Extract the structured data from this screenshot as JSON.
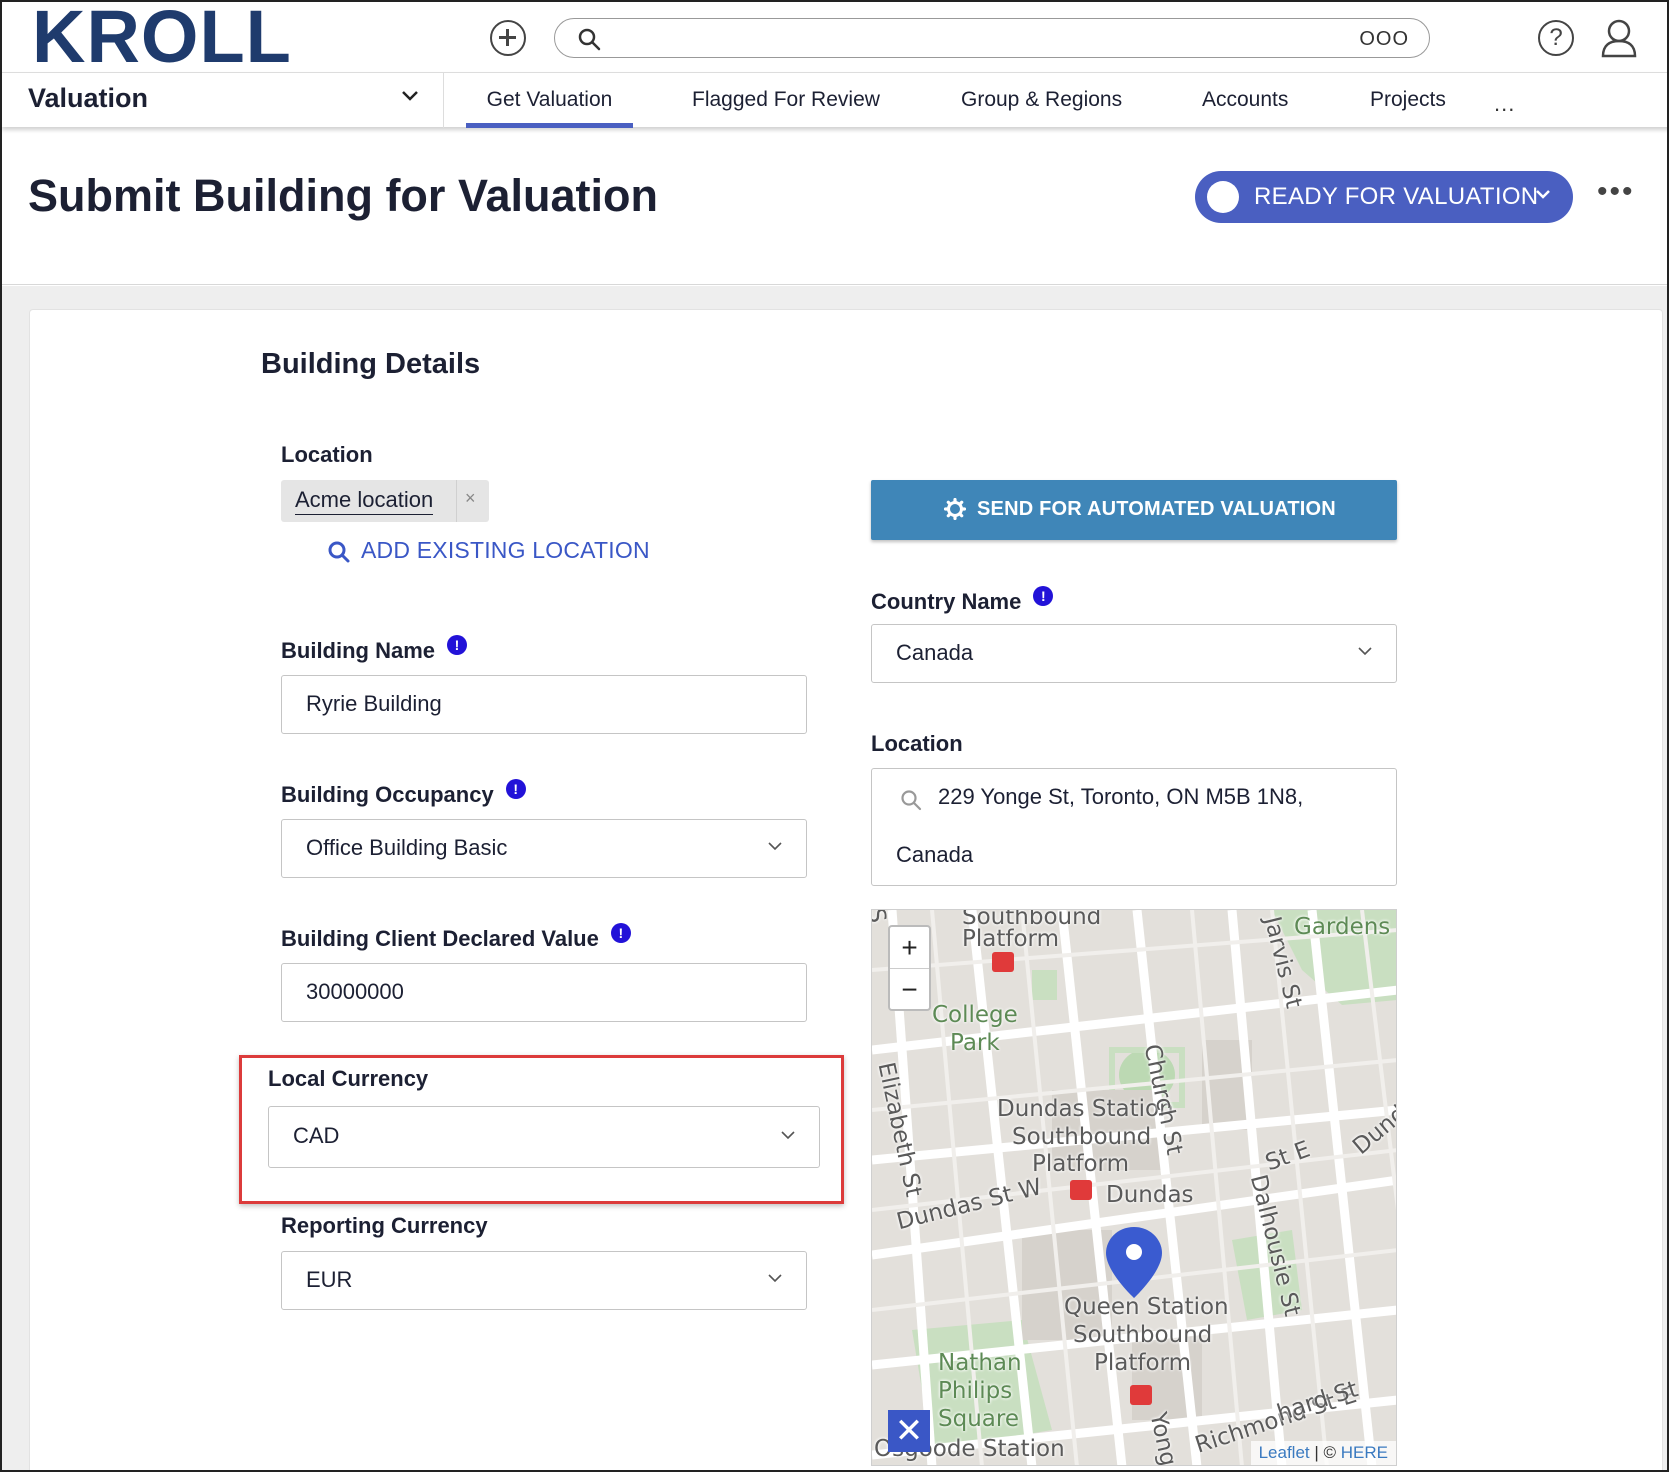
{
  "header": {
    "logo_text": "KROLL",
    "search_placeholder": "",
    "search_more": "OOO"
  },
  "nav": {
    "module": "Valuation",
    "tabs": [
      "Get Valuation",
      "Flagged For Review",
      "Group & Regions",
      "Accounts",
      "Projects"
    ],
    "active_tab": "Get Valuation",
    "more": "..."
  },
  "page": {
    "title": "Submit Building for Valuation",
    "status": "READY FOR VALUATION",
    "kebab": "•••"
  },
  "form": {
    "section_title": "Building Details",
    "location_label": "Location",
    "location_chip": "Acme location",
    "chip_remove": "×",
    "add_existing_location": "ADD EXISTING LOCATION",
    "building_name_label": "Building Name",
    "building_name_value": "Ryrie Building",
    "occupancy_label": "Building Occupancy",
    "occupancy_value": "Office Building Basic",
    "declared_value_label": "Building Client Declared Value",
    "declared_value": "30000000",
    "local_currency_label": "Local Currency",
    "local_currency_value": "CAD",
    "reporting_currency_label": "Reporting Currency",
    "reporting_currency_value": "EUR",
    "send_button": "SEND FOR AUTOMATED VALUATION",
    "country_label": "Country Name",
    "country_value": "Canada",
    "location2_label": "Location",
    "address_line1": "229 Yonge St, Toronto, ON M5B 1N8,",
    "address_line2": "Canada",
    "required_marker": "!"
  },
  "map": {
    "zoom_in": "+",
    "zoom_out": "−",
    "attribution_leaflet": "Leaflet",
    "attribution_sep": " | © ",
    "attribution_here": "HERE",
    "close": "✕",
    "labels": [
      "Southbound",
      "Platform",
      "College",
      "Park",
      "Gardens",
      "Dundas Station",
      "Southbound",
      "Platform",
      "Dundas",
      "Dundas St W",
      "Queen Station",
      "Southbound",
      "Platform",
      "Nathan",
      "Philips",
      "Square",
      "Osgoode Station",
      "Richmond St E",
      "Church St",
      "Jarvis St",
      "Dalhousie St",
      "Elizabeth St",
      "Yonge",
      "Dund",
      "St E",
      "hard St",
      "S"
    ]
  },
  "colors": {
    "brand_navy": "#1f3b6d",
    "accent": "#4a5fc1",
    "button_blue": "#3f86b8",
    "link_blue": "#3a57c6",
    "required": "#2212d8",
    "highlight_red": "#dc3b3b"
  }
}
